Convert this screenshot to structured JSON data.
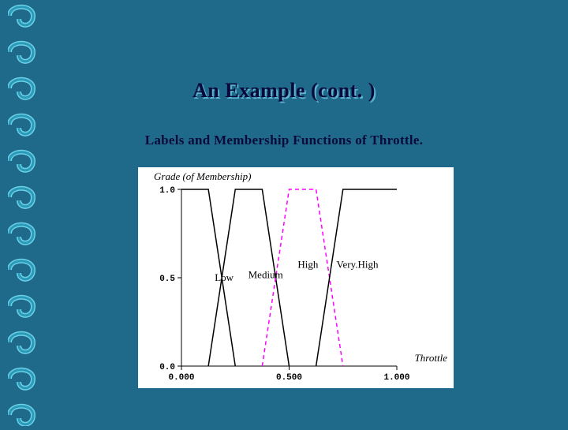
{
  "title": "An Example (cont. )",
  "subtitle": "Labels and Membership Functions of Throttle.",
  "chart_data": {
    "type": "line",
    "title": "Grade (of Membership)",
    "xlabel": "Throttle",
    "ylabel": "",
    "xlim": [
      0.0,
      1.0
    ],
    "ylim": [
      0.0,
      1.0
    ],
    "x": [
      0.0,
      0.125,
      0.25,
      0.375,
      0.5,
      0.625,
      0.75,
      0.875,
      1.0
    ],
    "series": [
      {
        "name": "Low",
        "color": "#000000",
        "values": [
          1.0,
          1.0,
          0.0,
          null,
          null,
          null,
          null,
          null,
          null
        ]
      },
      {
        "name": "Medium",
        "color": "#000000",
        "values": [
          null,
          0.0,
          1.0,
          1.0,
          0.0,
          null,
          null,
          null,
          null
        ]
      },
      {
        "name": "High",
        "color": "#ff00ff",
        "values": [
          null,
          null,
          null,
          0.0,
          1.0,
          1.0,
          0.0,
          null,
          null
        ],
        "dashed": true
      },
      {
        "name": "Very.High",
        "color": "#000000",
        "values": [
          null,
          null,
          null,
          null,
          null,
          0.0,
          1.0,
          1.0,
          1.0
        ]
      }
    ],
    "xticks": [
      {
        "v": 0.0,
        "label": "0.000"
      },
      {
        "v": 0.5,
        "label": "0.500"
      },
      {
        "v": 1.0,
        "label": "1.000"
      }
    ],
    "yticks": [
      {
        "v": 0.0,
        "label": "0.0"
      },
      {
        "v": 0.5,
        "label": "0.5"
      },
      {
        "v": 1.0,
        "label": "1.0"
      }
    ]
  }
}
